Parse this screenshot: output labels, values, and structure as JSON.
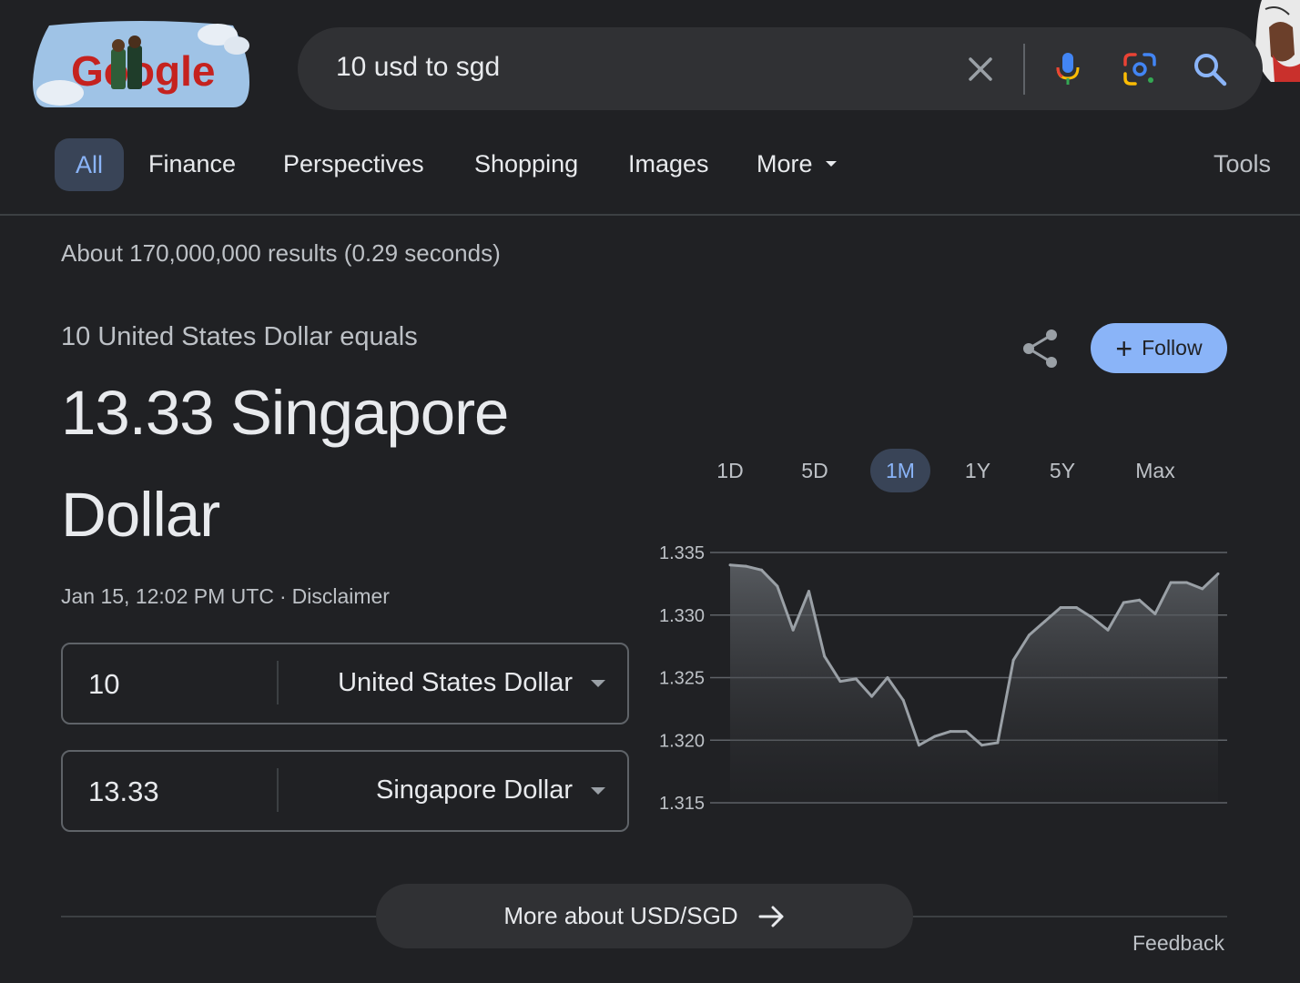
{
  "logo": {
    "text": "Google",
    "doodle_colors": {
      "sky": "#9fc3e6",
      "text": "#c5221f"
    }
  },
  "search": {
    "query": "10 usd to sgd"
  },
  "tabs": [
    {
      "label": "All",
      "active": true
    },
    {
      "label": "Finance"
    },
    {
      "label": "Perspectives"
    },
    {
      "label": "Shopping"
    },
    {
      "label": "Images"
    },
    {
      "label": "More"
    }
  ],
  "tools_label": "Tools",
  "result_stats": "About 170,000,000 results (0.29 seconds)",
  "converter": {
    "equals_label": "10 United States Dollar equals",
    "result_text": "13.33 Singapore Dollar",
    "timestamp": "Jan 15, 12:02 PM UTC",
    "disclaimer": "Disclaimer",
    "from": {
      "value": "10",
      "unit": "United States Dollar"
    },
    "to": {
      "value": "13.33",
      "unit": "Singapore Dollar"
    }
  },
  "follow_label": "Follow",
  "ranges": [
    {
      "label": "1D"
    },
    {
      "label": "5D"
    },
    {
      "label": "1M",
      "active": true
    },
    {
      "label": "1Y"
    },
    {
      "label": "5Y"
    },
    {
      "label": "Max"
    }
  ],
  "chart_data": {
    "type": "area",
    "title": "",
    "xlabel": "",
    "ylabel": "",
    "ylim": [
      1.315,
      1.335
    ],
    "yticks": [
      "1.335",
      "1.330",
      "1.325",
      "1.320",
      "1.315"
    ],
    "grid": true,
    "color": "#9aa0a6",
    "values": [
      1.334,
      1.3339,
      1.3336,
      1.3323,
      1.3288,
      1.3319,
      1.3267,
      1.3247,
      1.3249,
      1.3235,
      1.325,
      1.3232,
      1.3196,
      1.3203,
      1.3207,
      1.3207,
      1.3196,
      1.3198,
      1.3264,
      1.3284,
      1.3295,
      1.3306,
      1.3306,
      1.3298,
      1.3288,
      1.331,
      1.3312,
      1.3301,
      1.3326,
      1.3326,
      1.3321,
      1.3333
    ]
  },
  "more_button": "More about USD/SGD",
  "feedback": "Feedback",
  "colors": {
    "accent": "#8ab4f8",
    "background": "#202124",
    "surface": "#303134"
  }
}
